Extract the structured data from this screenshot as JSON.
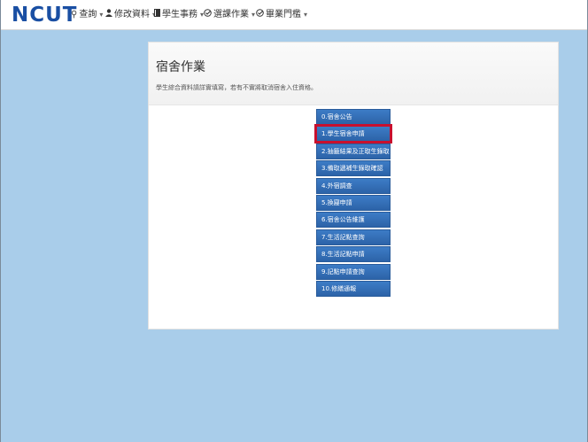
{
  "nav": {
    "logo": "NCUT",
    "items": [
      {
        "icon": "search-icon",
        "glyph": "⚲",
        "label": "查詢"
      },
      {
        "icon": "user-icon",
        "glyph": "👤",
        "label": "修改資料"
      },
      {
        "icon": "book-icon",
        "glyph": "▮",
        "label": "學生事務"
      },
      {
        "icon": "check-circle-icon",
        "glyph": "☑",
        "label": "選課作業"
      },
      {
        "icon": "check-circle-icon",
        "glyph": "☑",
        "label": "畢業門檻"
      }
    ],
    "caret": "▾"
  },
  "panel": {
    "title": "宿舍作業",
    "subtitle": "學生綜合資料請詳實填寫，若有不實將取消宿舍入住資格。"
  },
  "menu": {
    "items": [
      {
        "label": "0.宿舍公告"
      },
      {
        "label": "1.學生宿舍申請",
        "highlighted": true
      },
      {
        "label": "2.抽籤結果及正取生錄取確認"
      },
      {
        "label": "3.備取遞補生錄取確認"
      },
      {
        "label": "4.外宿調查"
      },
      {
        "label": "5.換寢申請"
      },
      {
        "label": "6.宿舍公告維護"
      },
      {
        "label": "7.生活記點查詢"
      },
      {
        "label": "8.生活記點申請"
      },
      {
        "label": "9.記點申請查詢"
      },
      {
        "label": "10.修繕通報"
      }
    ]
  },
  "colors": {
    "background": "#a9cdea",
    "brand": "#1a4fa3",
    "menu_button": "#2f6bb3",
    "highlight": "#c8102e"
  }
}
